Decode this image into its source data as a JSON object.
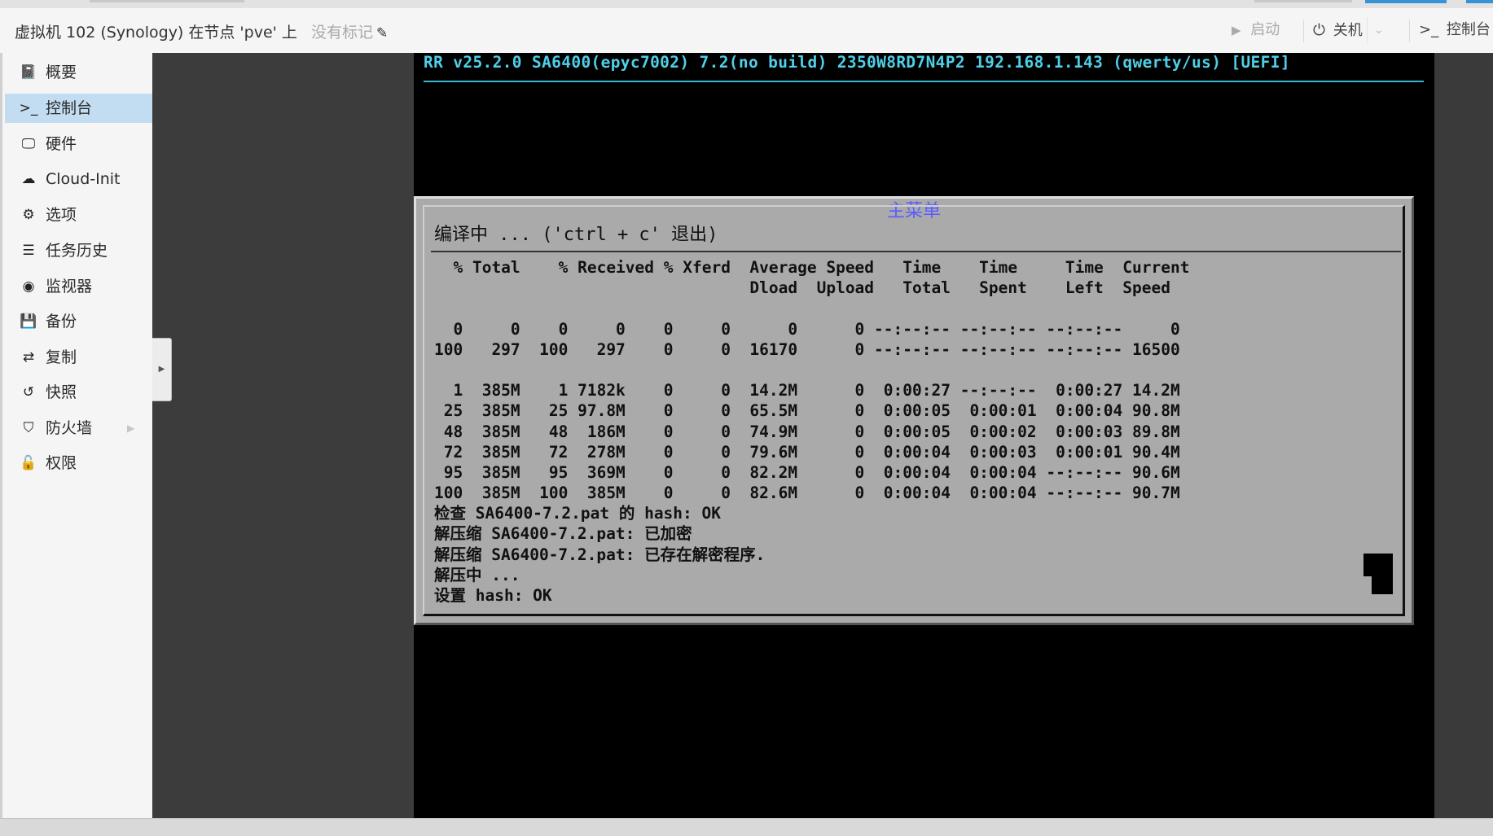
{
  "header": {
    "vm_title": "虚拟机 102 (Synology) 在节点 'pve' 上",
    "tags_placeholder": "没有标记",
    "start_label": "启动",
    "shutdown_label": "关机",
    "console_label": "控制台",
    "console_prompt": ">_"
  },
  "sidebar": {
    "items": [
      {
        "label": "概要",
        "icon": "book-icon",
        "glyph": "📓",
        "active": false
      },
      {
        "label": "控制台",
        "icon": "terminal-icon",
        "glyph": ">_",
        "active": true
      },
      {
        "label": "硬件",
        "icon": "monitor-icon",
        "glyph": "🖵",
        "active": false
      },
      {
        "label": "Cloud-Init",
        "icon": "cloud-icon",
        "glyph": "☁",
        "active": false
      },
      {
        "label": "选项",
        "icon": "gear-icon",
        "glyph": "⚙",
        "active": false
      },
      {
        "label": "任务历史",
        "icon": "list-icon",
        "glyph": "☰",
        "active": false
      },
      {
        "label": "监视器",
        "icon": "eye-icon",
        "glyph": "◉",
        "active": false
      },
      {
        "label": "备份",
        "icon": "floppy-icon",
        "glyph": "💾",
        "active": false
      },
      {
        "label": "复制",
        "icon": "retweet-icon",
        "glyph": "⇄",
        "active": false
      },
      {
        "label": "快照",
        "icon": "history-icon",
        "glyph": "↺",
        "active": false
      },
      {
        "label": "防火墙",
        "icon": "shield-icon",
        "glyph": "⛉",
        "active": false
      },
      {
        "label": "权限",
        "icon": "unlock-icon",
        "glyph": "🔓",
        "active": false
      }
    ]
  },
  "console": {
    "header_line": "RR v25.2.0 SA6400(epyc7002) 7.2(no build) 2350W8RD7N4P2 192.168.1.143 (qwerty/us) [UEFI]",
    "dialog_title": "主菜单",
    "dialog_heading": "编译中 ... ('ctrl + c' 退出)",
    "lines": [
      "  % Total    % Received % Xferd  Average Speed   Time    Time     Time  Current",
      "                                 Dload  Upload   Total   Spent    Left  Speed",
      "",
      "  0     0    0     0    0     0      0      0 --:--:-- --:--:-- --:--:--     0",
      "100   297  100   297    0     0  16170      0 --:--:-- --:--:-- --:--:-- 16500",
      "",
      "  1  385M    1 7182k    0     0  14.2M      0  0:00:27 --:--:--  0:00:27 14.2M",
      " 25  385M   25 97.8M    0     0  65.5M      0  0:00:05  0:00:01  0:00:04 90.8M",
      " 48  385M   48  186M    0     0  74.9M      0  0:00:05  0:00:02  0:00:03 89.8M",
      " 72  385M   72  278M    0     0  79.6M      0  0:00:04  0:00:03  0:00:01 90.4M",
      " 95  385M   95  369M    0     0  82.2M      0  0:00:04  0:00:04 --:--:-- 90.6M",
      "100  385M  100  385M    0     0  82.6M      0  0:00:04  0:00:04 --:--:-- 90.7M",
      "检查 SA6400-7.2.pat 的 hash: OK",
      "解压缩 SA6400-7.2.pat: 已加密",
      "解压缩 SA6400-7.2.pat: 已存在解密程序.",
      "解压中 ...",
      "设置 hash: OK"
    ]
  },
  "colors": {
    "console_header": "#4fd0e8",
    "dialog_bg": "#aaaaaa",
    "dialog_title": "#5a5cff",
    "sidebar_active": "#c2dcf2"
  }
}
